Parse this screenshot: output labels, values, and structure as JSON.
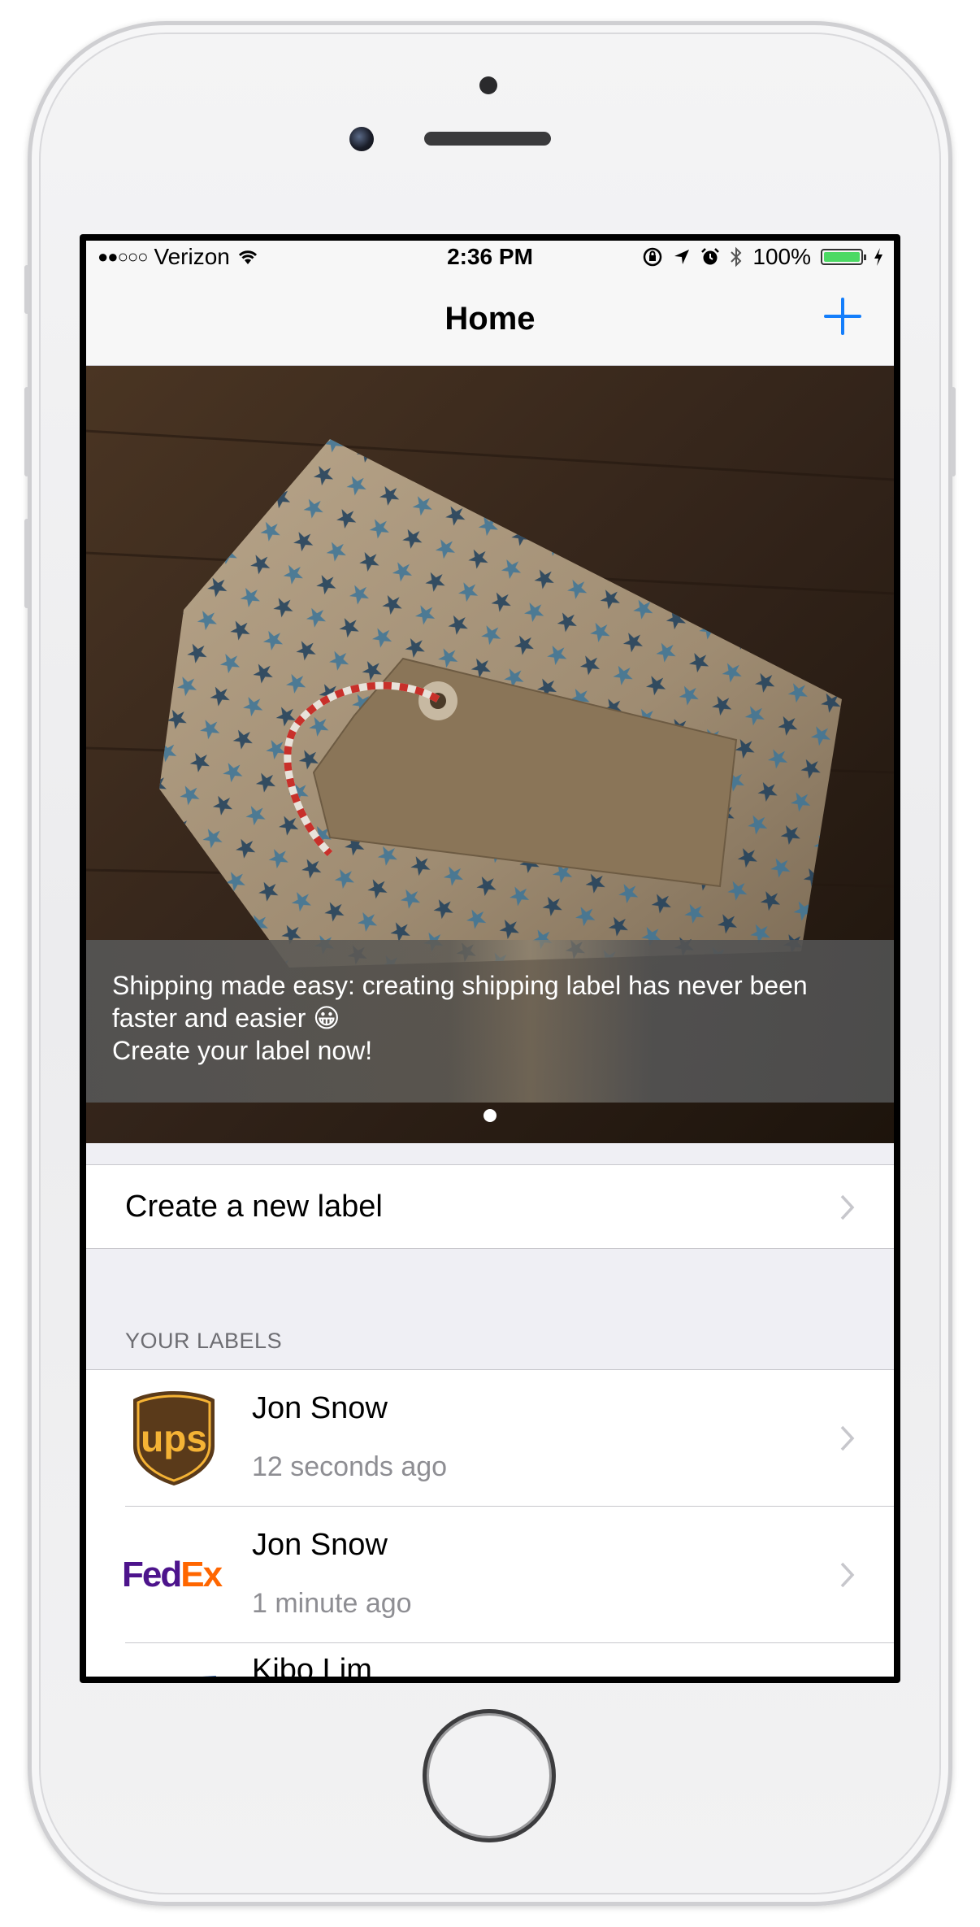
{
  "statusbar": {
    "signal": "●●○○○",
    "carrier": "Verizon",
    "time": "2:36 PM",
    "battery_percent": "100%",
    "battery_level": 1.0,
    "icons": [
      "wifi-icon",
      "rotation-lock-icon",
      "location-arrow-icon",
      "alarm-icon",
      "bluetooth-icon",
      "battery-icon",
      "charging-bolt-icon"
    ]
  },
  "navbar": {
    "title": "Home",
    "add_icon": "plus-icon"
  },
  "banner": {
    "caption_line1": "Shipping made easy: creating shipping label has never been faster and easier 😀",
    "caption_line2": "Create your label now!",
    "page_count": 1,
    "current_page": 1
  },
  "actions": {
    "create_label": "Create a new label"
  },
  "labels_section": {
    "header": "YOUR LABELS",
    "items": [
      {
        "name": "Jon Snow",
        "time": "12 seconds ago",
        "carrier_logo": "ups-logo"
      },
      {
        "name": "Jon Snow",
        "time": "1 minute ago",
        "carrier_logo": "fedex-logo",
        "logo_text_a": "Fed",
        "logo_text_b": "Ex"
      },
      {
        "name": "Kibo Lim",
        "time": "",
        "carrier_logo": "usps-logo"
      }
    ]
  },
  "colors": {
    "accent": "#147efb",
    "ups_brown": "#5a3a1a",
    "ups_gold": "#f5b335",
    "fedex_purple": "#4d148c",
    "fedex_orange": "#ff6600",
    "usps_blue": "#2a5ea8"
  }
}
